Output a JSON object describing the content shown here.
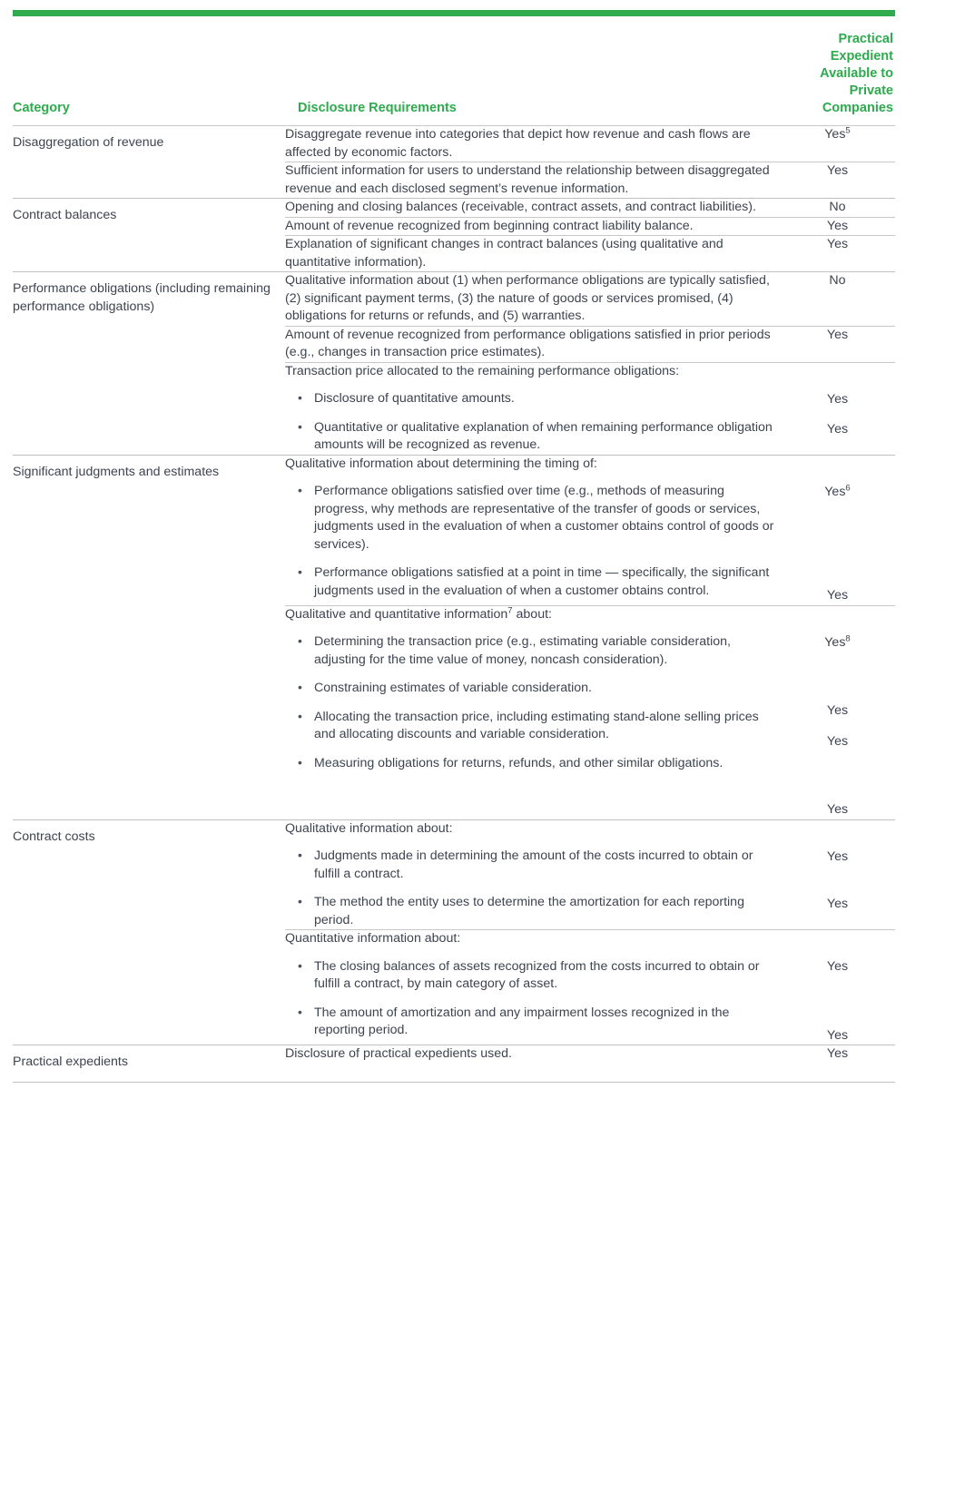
{
  "theme": {
    "accent_green": "#2eab4d",
    "text_color": "#3d4450",
    "rule_color": "#c0c0c0"
  },
  "header": {
    "col_category": "Category",
    "col_disclosure": "Disclosure Requirements",
    "col_practical_expedient": "Practical Expedient Available to Private Companies"
  },
  "rows": {
    "g1": {
      "category": "Disaggregation of revenue",
      "r1": {
        "text": "Disaggregate revenue into categories that depict how revenue and cash flows are affected by economic factors.",
        "answer": "Yes",
        "footnote": "5"
      },
      "r2": {
        "text": "Sufficient information for users to understand the relationship between disaggregated revenue and each disclosed segment’s revenue information.",
        "answer": "Yes"
      }
    },
    "g2": {
      "category": "Contract balances",
      "r1": {
        "text": "Opening and closing balances (receivable, contract assets, and contract liabilities).",
        "answer": "No"
      },
      "r2": {
        "text": "Amount of revenue recognized from beginning contract liability balance.",
        "answer": "Yes"
      },
      "r3": {
        "text": "Explanation of significant changes in contract balances (using qualitative and quantitative information).",
        "answer": "Yes"
      }
    },
    "g3": {
      "category": "Performance obligations (including remaining performance obligations)",
      "r1": {
        "text": "Qualitative information about (1) when performance obligations are typically satisfied, (2) significant payment terms, (3) the nature of goods or services promised, (4) obligations for returns or refunds, and (5) warranties.",
        "answer": "No"
      },
      "r2": {
        "text": "Amount of revenue recognized from performance obligations satisfied in prior periods (e.g., changes in transaction price estimates).",
        "answer": "Yes"
      },
      "r3": {
        "lead": "Transaction price allocated to the remaining performance obligations:",
        "b1": "Disclosure of quantitative amounts.",
        "b1_answer": "Yes",
        "b2": "Quantitative or qualitative explanation of when remaining performance obligation amounts will be recognized as revenue.",
        "b2_answer": "Yes"
      }
    },
    "g4": {
      "category": "Significant judgments and estimates",
      "r1": {
        "lead": "Qualitative information about determining the timing of:",
        "b1": "Performance obligations satisfied over time (e.g., methods of measuring progress, why methods are representative of the transfer of goods or services, judgments used in the evaluation of when a customer obtains control of goods or services).",
        "b1_answer": "Yes",
        "b1_footnote": "6",
        "b2": "Performance obligations satisfied at a point in time — specifically, the significant judgments used in the evaluation of when a customer obtains control.",
        "b2_answer": "Yes"
      },
      "r2": {
        "lead_pre": "Qualitative and quantitative information",
        "lead_footnote": "7",
        "lead_post": " about:",
        "b1": "Determining the transaction price (e.g., estimating variable consideration, adjusting for the time value of money, noncash consideration).",
        "b1_answer": "Yes",
        "b1_footnote": "8",
        "b2": "Constraining estimates of variable consideration.",
        "b2_answer": "Yes",
        "b3": "Allocating the transaction price, including estimating stand-alone selling prices and allocating discounts and variable consideration.",
        "b3_answer": "Yes",
        "b4": "Measuring obligations for returns, refunds, and other similar obligations.",
        "b4_answer": "Yes"
      }
    },
    "g5": {
      "category": "Contract costs",
      "r1": {
        "lead": "Qualitative information about:",
        "b1": "Judgments made in determining the amount of the costs incurred to obtain or fulfill a contract.",
        "b1_answer": "Yes",
        "b2": "The method the entity uses to determine the amortization for each reporting period.",
        "b2_answer": "Yes"
      },
      "r2": {
        "lead": "Quantitative information about:",
        "b1": "The closing balances of assets recognized from the costs incurred to obtain or fulfill a contract, by main category of asset.",
        "b1_answer": "Yes",
        "b2": "The amount of amortization and any impairment losses recognized in the reporting period.",
        "b2_answer": "Yes"
      }
    },
    "g6": {
      "category": "Practical expedients",
      "r1": {
        "text": "Disclosure of practical expedients used.",
        "answer": "Yes"
      }
    }
  }
}
